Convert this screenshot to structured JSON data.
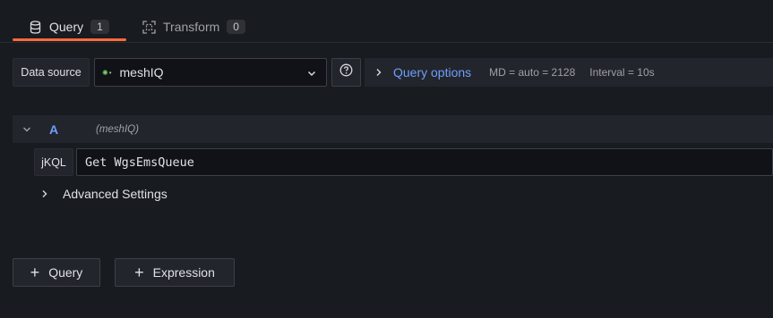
{
  "tabs": [
    {
      "label": "Query",
      "count": "1",
      "icon": "database-icon"
    },
    {
      "label": "Transform",
      "count": "0",
      "icon": "transform-icon"
    }
  ],
  "datasource": {
    "label": "Data source",
    "value": "meshIQ",
    "logo": "meshiq-logo"
  },
  "query_options": {
    "title": "Query options",
    "md": "MD = auto = 2128",
    "interval": "Interval = 10s"
  },
  "query": {
    "ref": "A",
    "source": "(meshIQ)",
    "field_label": "jKQL",
    "field_value": "Get WgsEmsQueue",
    "advanced_label": "Advanced Settings"
  },
  "buttons": {
    "add_query": "Query",
    "add_expression": "Expression"
  },
  "colors": {
    "background": "#181b1f",
    "panel": "#22252b",
    "accent_tab": "#ff6a3d",
    "link_blue": "#6e9fff"
  }
}
